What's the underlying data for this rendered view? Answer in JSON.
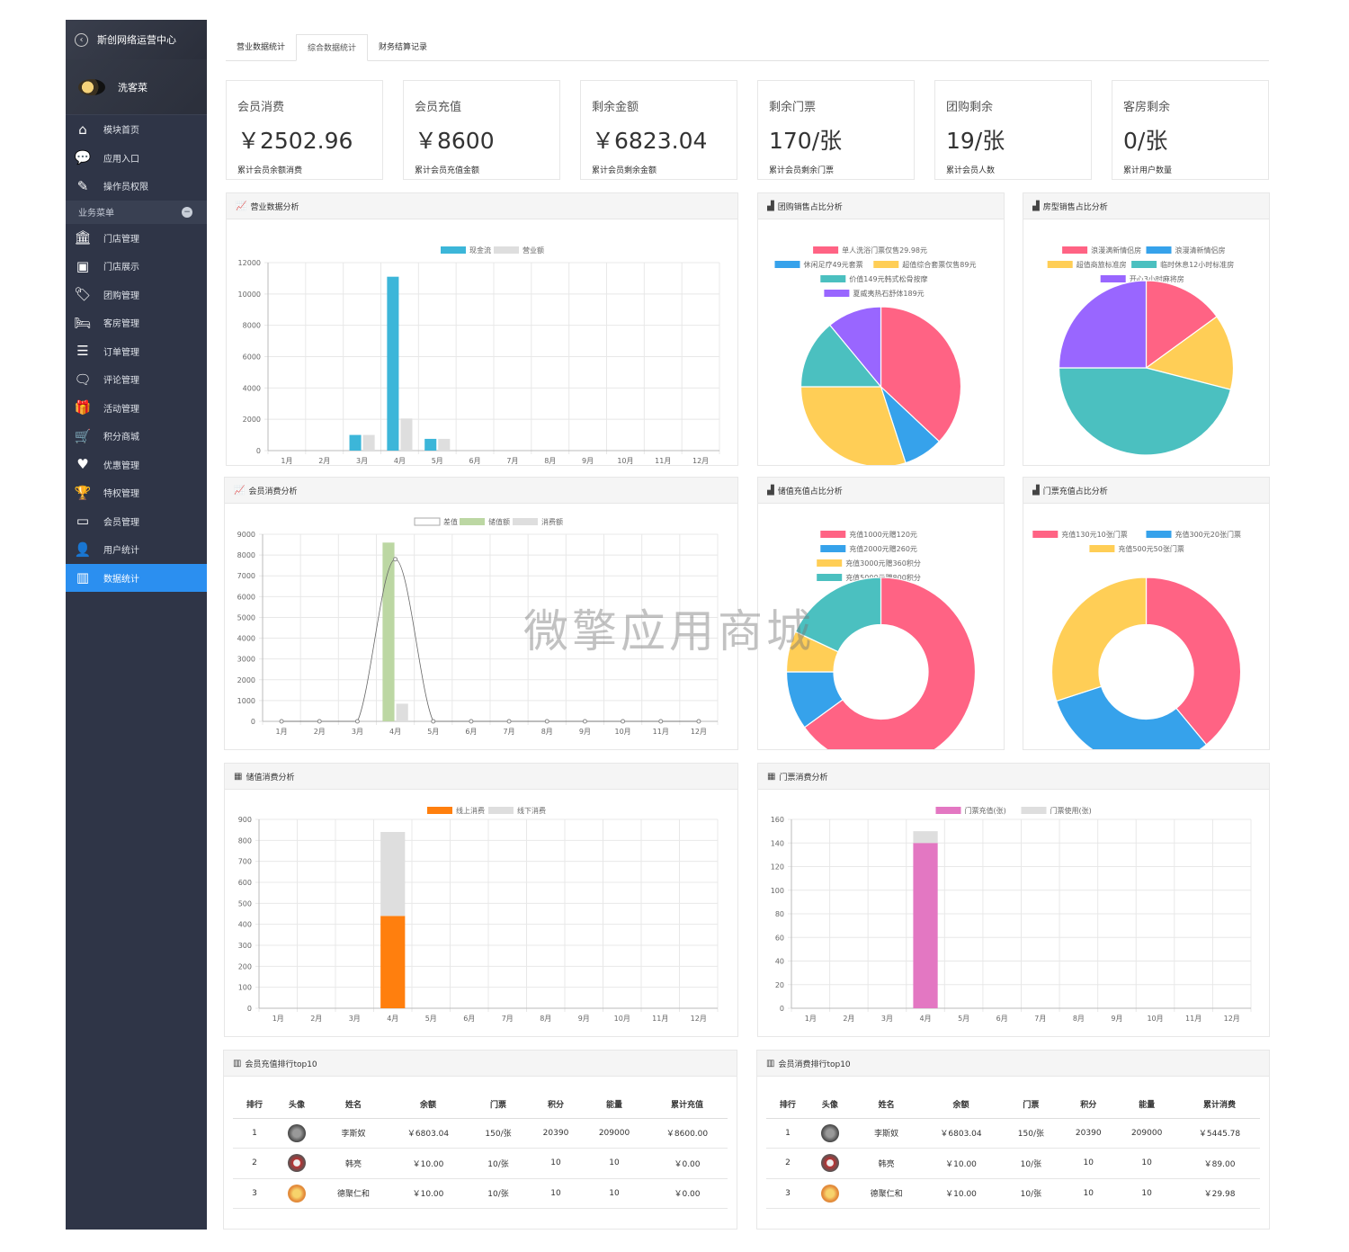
{
  "sidebar": {
    "header_title": "斯创网络运营中心",
    "user_name": "洗客菜",
    "top_items": [
      {
        "label": "模块首页",
        "icon": "home-icon"
      },
      {
        "label": "应用入口",
        "icon": "chat-bubble-icon"
      },
      {
        "label": "操作员权限",
        "icon": "edit-document-icon"
      }
    ],
    "section_label": "业务菜单",
    "items": [
      {
        "label": "门店管理",
        "icon": "bank-icon"
      },
      {
        "label": "门店展示",
        "icon": "picture-icon"
      },
      {
        "label": "团购管理",
        "icon": "tags-icon"
      },
      {
        "label": "客房管理",
        "icon": "bed-icon"
      },
      {
        "label": "订单管理",
        "icon": "list-icon"
      },
      {
        "label": "评论管理",
        "icon": "comments-icon"
      },
      {
        "label": "活动管理",
        "icon": "gift-icon"
      },
      {
        "label": "积分商城",
        "icon": "cart-icon"
      },
      {
        "label": "优惠管理",
        "icon": "heart-icon"
      },
      {
        "label": "特权管理",
        "icon": "trophy-icon"
      },
      {
        "label": "会员管理",
        "icon": "credit-card-icon"
      },
      {
        "label": "用户统计",
        "icon": "user-icon"
      },
      {
        "label": "数据统计",
        "icon": "bar-chart-icon",
        "active": true
      }
    ]
  },
  "tabs": [
    {
      "label": "营业数据统计"
    },
    {
      "label": "综合数据统计",
      "active": true
    },
    {
      "label": "财务结算记录"
    }
  ],
  "stats": [
    {
      "title": "会员消费",
      "value": "￥2502.96",
      "sub": "累计会员余额消费"
    },
    {
      "title": "会员充值",
      "value": "￥8600",
      "sub": "累计会员充值金额"
    },
    {
      "title": "剩余金额",
      "value": "￥6823.04",
      "sub": "累计会员剩余金额"
    },
    {
      "title": "剩余门票",
      "value": "170/张",
      "sub": "累计会员剩余门票"
    },
    {
      "title": "团购剩余",
      "value": "19/张",
      "sub": "累计会员人数"
    },
    {
      "title": "客房剩余",
      "value": "0/张",
      "sub": "累计用户数量"
    }
  ],
  "panels": {
    "revenue": "营业数据分析",
    "group": "团购销售占比分析",
    "room": "房型销售占比分析",
    "member": "会员消费分析",
    "stored": "储值充值占比分析",
    "ticket": "门票充值占比分析",
    "stored_consume": "储值消费分析",
    "ticket_consume": "门票消费分析",
    "recharge_top": "会员充值排行top10",
    "consume_top": "会员消费排行top10"
  },
  "chart_data": [
    {
      "id": "revenue",
      "type": "bar",
      "title": "营业数据分析",
      "categories": [
        "1月",
        "2月",
        "3月",
        "4月",
        "5月",
        "6月",
        "7月",
        "8月",
        "9月",
        "10月",
        "11月",
        "12月"
      ],
      "series": [
        {
          "name": "现金流",
          "color": "#3cb6d9",
          "values": [
            0,
            0,
            1000,
            11100,
            750,
            0,
            0,
            0,
            0,
            0,
            0,
            0
          ]
        },
        {
          "name": "营业额",
          "color": "#dedede",
          "values": [
            0,
            0,
            1000,
            2050,
            750,
            0,
            0,
            0,
            0,
            0,
            0,
            0
          ]
        }
      ],
      "yticks": [
        "0",
        "2000",
        "4000",
        "6000",
        "8000",
        "10000",
        "12000"
      ],
      "ylim": [
        0,
        12000
      ],
      "grid": true,
      "legend": "top"
    },
    {
      "id": "group",
      "type": "pie",
      "title": "团购销售占比分析",
      "labels": [
        "单人洗浴门票仅售29.98元",
        "休闲足疗49元套票",
        "超值综合套票仅售89元",
        "价值149元韩式松骨按摩",
        "夏威夷热石舒体189元"
      ],
      "colors": [
        "#ff6384",
        "#36a2eb",
        "#ffce56",
        "#4bc0c0",
        "#9966ff"
      ],
      "values": [
        37,
        8,
        30,
        14,
        11
      ],
      "legend": "top"
    },
    {
      "id": "room",
      "type": "pie",
      "title": "房型销售占比分析",
      "labels": [
        "浪漫满新情侣房",
        "浪漫清新情侣房",
        "超值商旅标准房",
        "临时休息12小时标准房",
        "开心3小时麻将房"
      ],
      "colors": [
        "#ff6384",
        "#36a2eb",
        "#ffce56",
        "#4bc0c0",
        "#9966ff"
      ],
      "values": [
        15,
        0,
        14,
        46,
        25
      ],
      "legend": "top"
    },
    {
      "id": "member",
      "type": "bar",
      "title": "会员消费分析",
      "categories": [
        "1月",
        "2月",
        "3月",
        "4月",
        "5月",
        "6月",
        "7月",
        "8月",
        "9月",
        "10月",
        "11月",
        "12月"
      ],
      "series": [
        {
          "name": "差值",
          "color": "#ffffff",
          "type": "line",
          "values": [
            0,
            0,
            0,
            7800,
            0,
            0,
            0,
            0,
            0,
            0,
            0,
            0
          ]
        },
        {
          "name": "储值额",
          "color": "#bcd7a3",
          "values": [
            0,
            0,
            0,
            8600,
            0,
            0,
            0,
            0,
            0,
            0,
            0,
            0
          ]
        },
        {
          "name": "消费额",
          "color": "#dedede",
          "values": [
            0,
            0,
            0,
            850,
            0,
            0,
            0,
            0,
            0,
            0,
            0,
            0
          ]
        }
      ],
      "yticks": [
        "0",
        "1000",
        "2000",
        "3000",
        "4000",
        "5000",
        "6000",
        "7000",
        "8000",
        "9000"
      ],
      "ylim": [
        0,
        9000
      ],
      "grid": true,
      "legend": "top"
    },
    {
      "id": "stored",
      "type": "pie",
      "title": "储值充值占比分析",
      "labels": [
        "充值1000元赠120元",
        "充值2000元赠260元",
        "充值3000元赠360积分",
        "充值5000元赠800积分"
      ],
      "colors": [
        "#ff6384",
        "#36a2eb",
        "#ffce56",
        "#4bc0c0"
      ],
      "values": [
        65,
        10,
        7,
        18
      ],
      "donut": true,
      "legend": "top"
    },
    {
      "id": "ticket",
      "type": "pie",
      "title": "门票充值占比分析",
      "labels": [
        "充值130元10张门票",
        "充值300元20张门票",
        "充值500元50张门票"
      ],
      "colors": [
        "#ff6384",
        "#36a2eb",
        "#ffce56"
      ],
      "values": [
        39,
        31,
        30
      ],
      "donut": true,
      "legend": "top"
    },
    {
      "id": "stored_consume",
      "type": "bar",
      "title": "储值消费分析",
      "categories": [
        "1月",
        "2月",
        "3月",
        "4月",
        "5月",
        "6月",
        "7月",
        "8月",
        "9月",
        "10月",
        "11月",
        "12月"
      ],
      "stacked": true,
      "series": [
        {
          "name": "线上消费",
          "color": "#ff7f0e",
          "values": [
            0,
            0,
            0,
            440,
            0,
            0,
            0,
            0,
            0,
            0,
            0,
            0
          ]
        },
        {
          "name": "线下消费",
          "color": "#dedede",
          "values": [
            0,
            0,
            0,
            400,
            0,
            0,
            0,
            0,
            0,
            0,
            0,
            0
          ]
        }
      ],
      "yticks": [
        "0",
        "100",
        "200",
        "300",
        "400",
        "500",
        "600",
        "700",
        "800",
        "900"
      ],
      "ylim": [
        0,
        900
      ],
      "grid": true,
      "legend": "top"
    },
    {
      "id": "ticket_consume",
      "type": "bar",
      "title": "门票消费分析",
      "categories": [
        "1月",
        "2月",
        "3月",
        "4月",
        "5月",
        "6月",
        "7月",
        "8月",
        "9月",
        "10月",
        "11月",
        "12月"
      ],
      "stacked": true,
      "series": [
        {
          "name": "门票充值(张)",
          "color": "#e377c2",
          "values": [
            0,
            0,
            0,
            140,
            0,
            0,
            0,
            0,
            0,
            0,
            0,
            0
          ]
        },
        {
          "name": "门票使用(张)",
          "color": "#dedede",
          "values": [
            0,
            0,
            0,
            10,
            0,
            0,
            0,
            0,
            0,
            0,
            0,
            0
          ]
        }
      ],
      "yticks": [
        "0",
        "20",
        "40",
        "60",
        "80",
        "100",
        "120",
        "140",
        "160"
      ],
      "ylim": [
        0,
        160
      ],
      "grid": true,
      "legend": "top"
    }
  ],
  "tables": {
    "recharge": {
      "headers": [
        "排行",
        "头像",
        "姓名",
        "余额",
        "门票",
        "积分",
        "能量",
        "累计充值"
      ],
      "rows": [
        [
          "1",
          "",
          "李斯奴",
          "￥6803.04",
          "150/张",
          "20390",
          "209000",
          "￥8600.00"
        ],
        [
          "2",
          "",
          "韩亮",
          "￥10.00",
          "10/张",
          "10",
          "10",
          "￥0.00"
        ],
        [
          "3",
          "",
          "德聚仁和",
          "￥10.00",
          "10/张",
          "10",
          "10",
          "￥0.00"
        ]
      ]
    },
    "consume": {
      "headers": [
        "排行",
        "头像",
        "姓名",
        "余额",
        "门票",
        "积分",
        "能量",
        "累计消费"
      ],
      "rows": [
        [
          "1",
          "",
          "李斯奴",
          "￥6803.04",
          "150/张",
          "20390",
          "209000",
          "￥5445.78"
        ],
        [
          "2",
          "",
          "韩亮",
          "￥10.00",
          "10/张",
          "10",
          "10",
          "￥89.00"
        ],
        [
          "3",
          "",
          "德聚仁和",
          "￥10.00",
          "10/张",
          "10",
          "10",
          "￥29.98"
        ]
      ]
    }
  },
  "watermark": "微擎应用商城"
}
